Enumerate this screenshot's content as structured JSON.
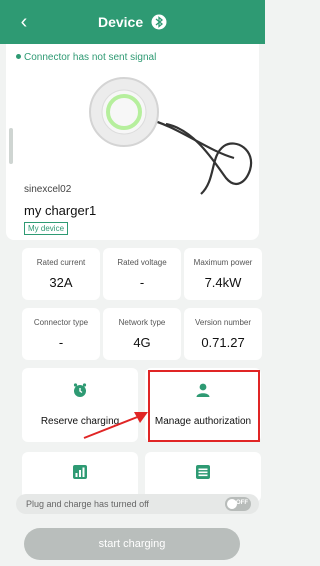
{
  "header": {
    "title": "Device",
    "back_icon": "chevron-left-icon",
    "bluetooth_icon": "bluetooth-icon"
  },
  "status": {
    "signal_text": "Connector has not sent signal",
    "color": "#2e9a73"
  },
  "device": {
    "id": "sinexcel02",
    "name": "my charger1",
    "badge": "My device"
  },
  "stats": [
    {
      "label": "Rated current",
      "value": "32A"
    },
    {
      "label": "Rated voltage",
      "value": "-"
    },
    {
      "label": "Maximum power",
      "value": "7.4kW"
    },
    {
      "label": "Connector type",
      "value": "-"
    },
    {
      "label": "Network type",
      "value": "4G"
    },
    {
      "label": "Version number",
      "value": "0.71.27"
    }
  ],
  "actions": [
    {
      "label": "Reserve charging",
      "icon": "clock-icon"
    },
    {
      "label": "Manage authorization",
      "icon": "user-icon"
    }
  ],
  "lower_actions": [
    {
      "icon": "chart-icon"
    },
    {
      "icon": "settings-list-icon"
    }
  ],
  "plug_and_charge": {
    "text": "Plug and charge has turned off",
    "toggle_text": "OFF"
  },
  "start_button": {
    "label": "start charging"
  },
  "colors": {
    "accent": "#2e9a73",
    "highlight": "#e02525",
    "disabled": "#b9bebc"
  }
}
